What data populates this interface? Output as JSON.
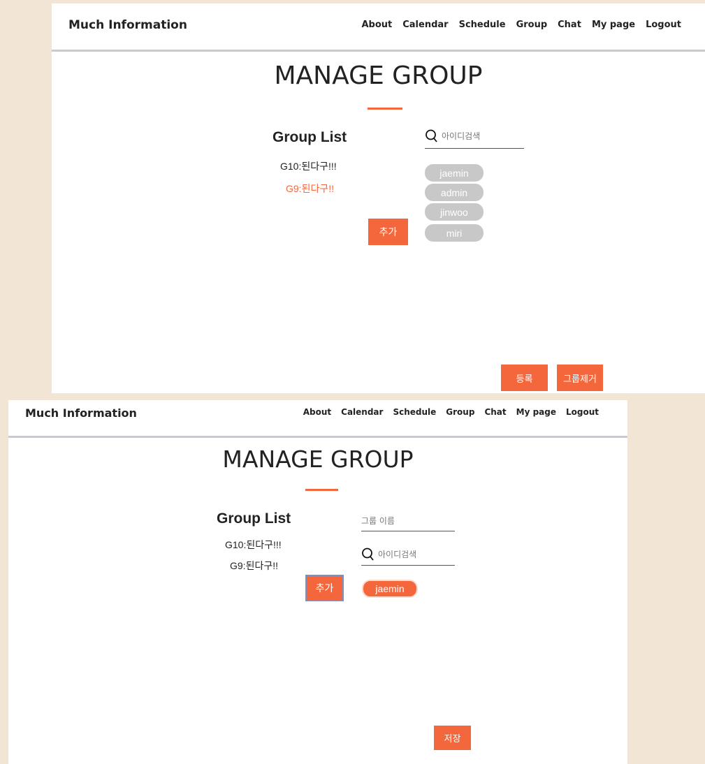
{
  "brand": "Much Information",
  "nav": [
    "About",
    "Calendar",
    "Schedule",
    "Group",
    "Chat",
    "My page",
    "Logout"
  ],
  "title": "MANAGE GROUP",
  "group_list_title": "Group List",
  "groups": [
    "G10:된다구!!!",
    "G9:된다구!!"
  ],
  "add_label": "추가",
  "search_placeholder": "아이디검색",
  "top_panel": {
    "users": [
      "jaemin",
      "admin",
      "jinwoo",
      "miri"
    ],
    "register_label": "등록",
    "remove_group_label": "그룹제거"
  },
  "bottom_panel": {
    "group_name_placeholder": "그룹 이름",
    "selected_users": [
      "jaemin"
    ],
    "save_label": "저장"
  },
  "colors": {
    "accent": "#f4673c",
    "chip_inactive": "#c8c8c8",
    "background": "#f3e5d6"
  }
}
